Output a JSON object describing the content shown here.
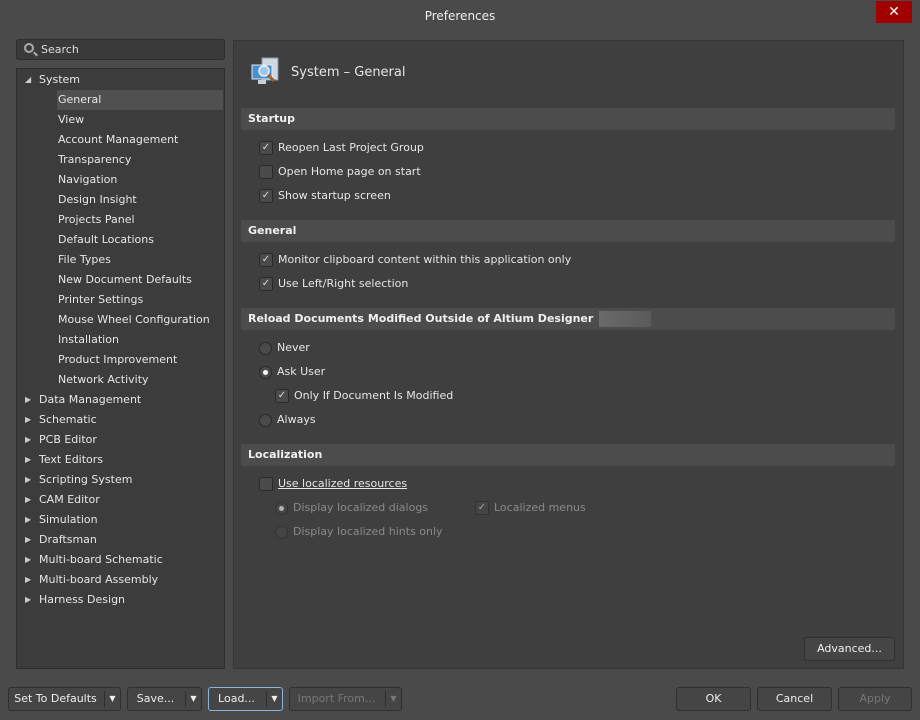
{
  "window": {
    "title": "Preferences",
    "close": "✕"
  },
  "search": {
    "placeholder": "Search"
  },
  "tree": [
    {
      "label": "System",
      "expanded": true,
      "children": [
        "General",
        "View",
        "Account Management",
        "Transparency",
        "Navigation",
        "Design Insight",
        "Projects Panel",
        "Default Locations",
        "File Types",
        "New Document Defaults",
        "Printer Settings",
        "Mouse Wheel Configuration",
        "Installation",
        "Product Improvement",
        "Network Activity"
      ]
    },
    {
      "label": "Data Management"
    },
    {
      "label": "Schematic"
    },
    {
      "label": "PCB Editor"
    },
    {
      "label": "Text Editors"
    },
    {
      "label": "Scripting System"
    },
    {
      "label": "CAM Editor"
    },
    {
      "label": "Simulation"
    },
    {
      "label": "Draftsman"
    },
    {
      "label": "Multi-board Schematic"
    },
    {
      "label": "Multi-board Assembly"
    },
    {
      "label": "Harness Design"
    }
  ],
  "page": {
    "title": "System – General",
    "startup": {
      "header": "Startup",
      "reopen": "Reopen Last Project Group",
      "home": "Open Home page on start",
      "splash": "Show startup screen"
    },
    "general": {
      "header": "General",
      "clipboard": "Monitor clipboard content within this application only",
      "leftright": "Use Left/Right selection"
    },
    "reload": {
      "header": "Reload Documents Modified Outside of Altium Designer",
      "never": "Never",
      "ask": "Ask User",
      "only_modified": "Only If Document Is Modified",
      "always": "Always"
    },
    "localization": {
      "header": "Localization",
      "use": "Use localized resources",
      "dialogs": "Display localized dialogs",
      "menus": "Localized menus",
      "hints": "Display localized hints only"
    },
    "advanced": "Advanced..."
  },
  "footer": {
    "defaults": "Set To Defaults",
    "save": "Save...",
    "load": "Load...",
    "import": "Import From...",
    "ok": "OK",
    "cancel": "Cancel",
    "apply": "Apply"
  }
}
